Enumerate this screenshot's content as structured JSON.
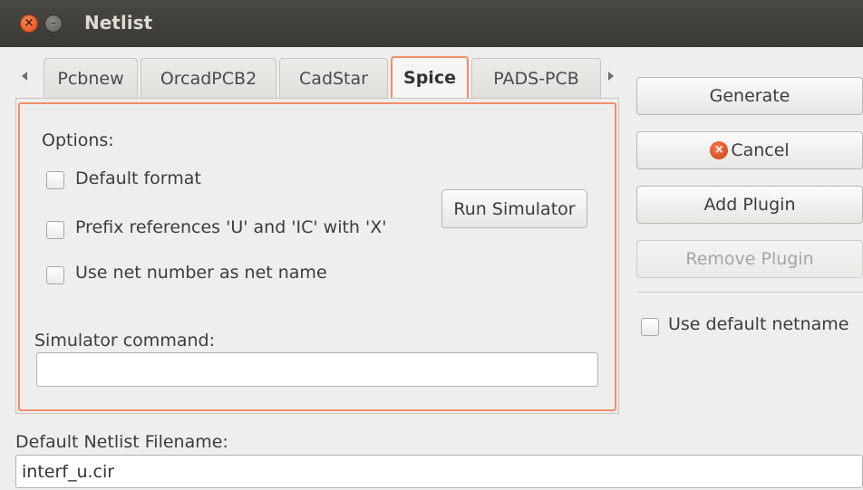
{
  "window": {
    "title": "Netlist",
    "close_glyph": "×",
    "minimize_glyph": "–"
  },
  "tabs": [
    {
      "label": "Pcbnew",
      "active": false
    },
    {
      "label": "OrcadPCB2",
      "active": false
    },
    {
      "label": "CadStar",
      "active": false
    },
    {
      "label": "Spice",
      "active": true
    },
    {
      "label": "PADS-PCB",
      "active": false
    }
  ],
  "spice": {
    "options_label": "Options:",
    "checkboxes": [
      {
        "label": "Default format",
        "checked": false
      },
      {
        "label": "Prefix references 'U' and 'IC' with 'X'",
        "checked": false
      },
      {
        "label": "Use net number as net name",
        "checked": false
      }
    ],
    "run_simulator_label": "Run Simulator",
    "simulator_command_label": "Simulator command:",
    "simulator_command_value": ""
  },
  "side_buttons": {
    "generate": "Generate",
    "cancel": "Cancel",
    "add_plugin": "Add Plugin",
    "remove_plugin": "Remove Plugin",
    "use_default_netname": "Use default netname"
  },
  "filename": {
    "label": "Default Netlist Filename:",
    "value": "interf_u.cir"
  },
  "colors": {
    "accent": "#ef8e6a",
    "titlebar": "#3b3935",
    "cancel_icon": "#d23d10"
  }
}
